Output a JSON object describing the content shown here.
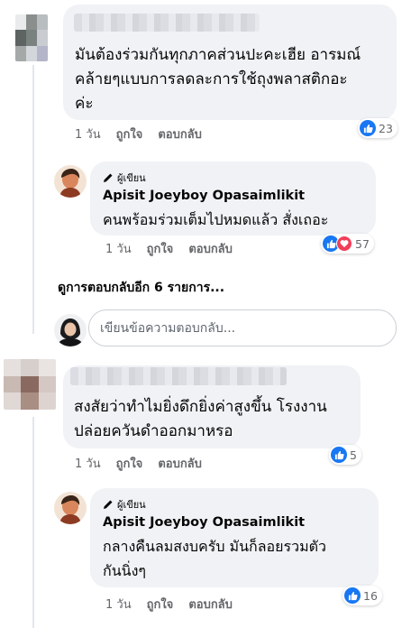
{
  "comments": [
    {
      "text_lines": [
        "มันต้องร่วมกันทุกภาคส่วนปะคะเฮีย อารมณ์",
        "คล้ายๆแบบการลดละการใช้ถุงพลาสติกอะ",
        "ค่ะ"
      ],
      "time": "1 วัน",
      "like_label": "ถูกใจ",
      "reply_label": "ตอบกลับ",
      "reaction_count": "23",
      "reaction_icons": [
        "like-icon"
      ]
    },
    {
      "text_lines": [
        "สงสัยว่าทำไมยิ่งดึกยิ่งค่าสูงขึ้น โรงงาน",
        "ปล่อยควันดำออกมาหรอ"
      ],
      "time": "1 วัน",
      "like_label": "ถูกใจ",
      "reply_label": "ตอบกลับ",
      "reaction_count": "5",
      "reaction_icons": [
        "like-icon"
      ]
    }
  ],
  "replies": [
    {
      "author_badge": "ผู้เขียน",
      "author": "Apisit Joeyboy Opasaimlikit",
      "text_lines": [
        "คนพร้อมร่วมเต็มไปหมดแล้ว สั่งเถอะ"
      ],
      "time": "1 วัน",
      "like_label": "ถูกใจ",
      "reply_label": "ตอบกลับ",
      "reaction_count": "57",
      "reaction_icons": [
        "like-icon",
        "love-icon"
      ]
    },
    {
      "author_badge": "ผู้เขียน",
      "author": "Apisit Joeyboy Opasaimlikit",
      "text_lines": [
        "กลางคืนลมสงบครับ มันก็ลอยรวมตัว",
        "กันนิ่งๆ"
      ],
      "time": "1 วัน",
      "like_label": "ถูกใจ",
      "reply_label": "ตอบกลับ",
      "reaction_count": "16",
      "reaction_icons": [
        "like-icon"
      ]
    }
  ],
  "more_replies_label": "ดูการตอบกลับอีก 6 รายการ...",
  "reply_box": {
    "placeholder": "เขียนข้อความตอบกลับ..."
  },
  "colors": {
    "bubble": "#f0f2f5",
    "meta_text": "#65676b",
    "like_blue": "#1877f2",
    "love_red": "#f33e58"
  }
}
